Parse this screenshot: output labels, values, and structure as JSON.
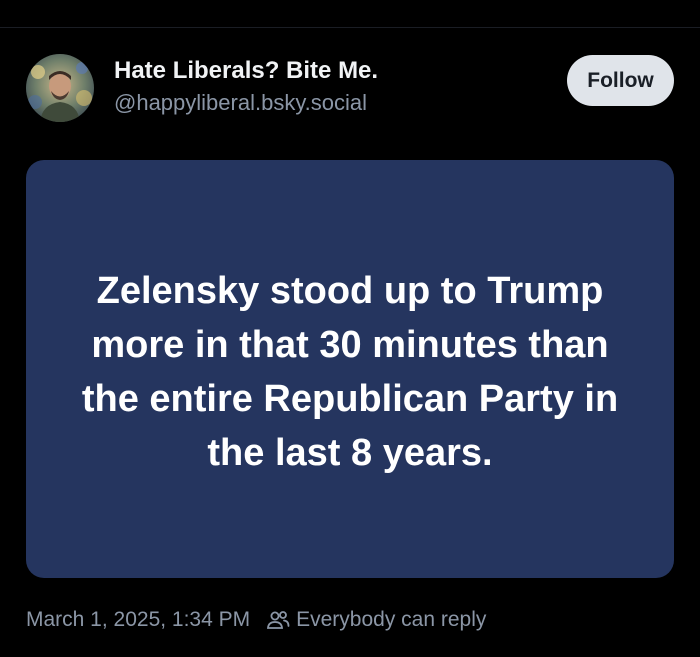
{
  "post": {
    "author": {
      "display_name": "Hate Liberals? Bite Me.",
      "handle": "@happyliberal.bsky.social",
      "avatar_icon": "profile-photo"
    },
    "follow_label": "Follow",
    "image_text": "Zelensky stood up to Trump more in that 30 minutes than the entire Republican Party in the last 8 years.",
    "timestamp": "March 1, 2025, 1:34 PM",
    "reply_setting": "Everybody can reply",
    "reply_icon": "people-icon"
  },
  "colors": {
    "background": "#000000",
    "card": "#25355f",
    "follow_button": "#e0e4ea",
    "muted_text": "#8b96a6"
  }
}
